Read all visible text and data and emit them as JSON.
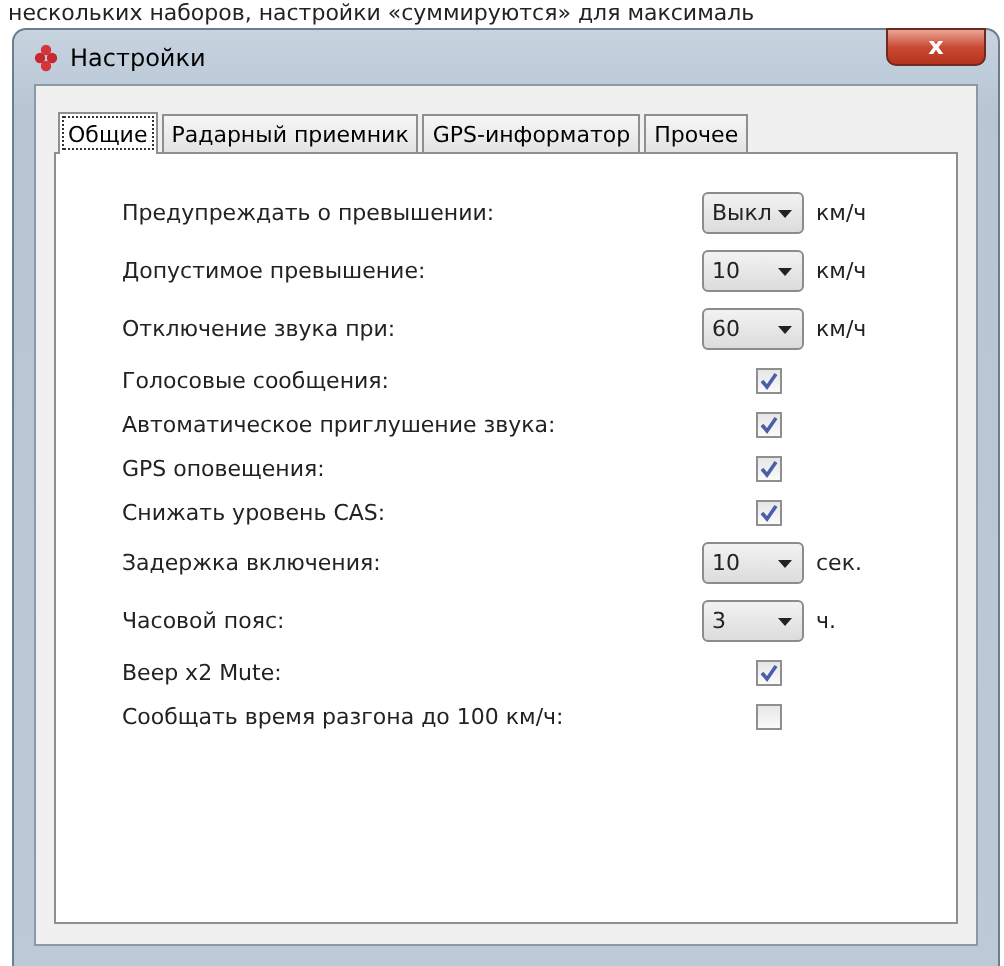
{
  "page_text": "нескольких наборов, настройки «суммируются» для максималь",
  "window": {
    "title": "Настройки",
    "close": "x"
  },
  "tabs": [
    {
      "label": "Общие",
      "selected": true
    },
    {
      "label": "Радарный приемник",
      "selected": false
    },
    {
      "label": "GPS-информатор",
      "selected": false
    },
    {
      "label": "Прочее",
      "selected": false
    }
  ],
  "rows": [
    {
      "kind": "select",
      "label": "Предупреждать о превышении:",
      "value": "Выкл",
      "unit": "км/ч"
    },
    {
      "kind": "select",
      "label": "Допустимое превышение:",
      "value": "10",
      "unit": "км/ч"
    },
    {
      "kind": "select",
      "label": "Отключение звука при:",
      "value": "60",
      "unit": "км/ч"
    },
    {
      "kind": "check",
      "label": "Голосовые сообщения:",
      "checked": true
    },
    {
      "kind": "check",
      "label": "Автоматическое приглушение звука:",
      "checked": true
    },
    {
      "kind": "check",
      "label": "GPS оповещения:",
      "checked": true
    },
    {
      "kind": "check",
      "label": "Снижать уровень CAS:",
      "checked": true
    },
    {
      "kind": "select",
      "label": "Задержка включения:",
      "value": "10",
      "unit": "сек."
    },
    {
      "kind": "select",
      "label": "Часовой пояс:",
      "value": "3",
      "unit": "ч."
    },
    {
      "kind": "check",
      "label": "Beep x2 Mute:",
      "checked": true
    },
    {
      "kind": "check",
      "label": "Сообщать время разгона до 100 км/ч:",
      "checked": false
    }
  ]
}
